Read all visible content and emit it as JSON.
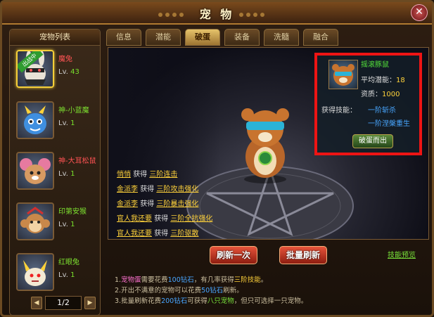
{
  "window": {
    "title": "宠 物",
    "close_label": "✕"
  },
  "sidebar": {
    "title": "宠物列表",
    "items": [
      {
        "name": "魔兔",
        "level_prefix": "Lv.",
        "level": "43",
        "badge": "出战中"
      },
      {
        "name": "神-小蓝魔",
        "level_prefix": "Lv.",
        "level": "1"
      },
      {
        "name": "神-大耳松鼠",
        "level_prefix": "Lv.",
        "level": "1"
      },
      {
        "name": "印第安猴",
        "level_prefix": "Lv.",
        "level": "1"
      },
      {
        "name": "红眼兔",
        "level_prefix": "Lv.",
        "level": "1"
      }
    ],
    "pager": {
      "page": "1/2",
      "prev": "◀",
      "next": "▶"
    }
  },
  "tabs": [
    {
      "label": "信息"
    },
    {
      "label": "潜能"
    },
    {
      "label": "破蛋"
    },
    {
      "label": "装备"
    },
    {
      "label": "洗髓"
    },
    {
      "label": "融合"
    }
  ],
  "stage": {
    "results": [
      {
        "user": "悄悄",
        "verb": "获得",
        "skill": "三阶连击"
      },
      {
        "user": "金派李",
        "verb": "获得",
        "skill": "三阶攻击强化"
      },
      {
        "user": "金派李",
        "verb": "获得",
        "skill": "三阶暴击强化"
      },
      {
        "user": "官人我还要",
        "verb": "获得",
        "skill": "三阶全抗强化"
      },
      {
        "user": "官人我还要",
        "verb": "获得",
        "skill": "三阶驱散"
      }
    ]
  },
  "info_panel": {
    "name": "摇滚豚鼠",
    "potential_label": "平均潜能：",
    "potential_value": "18",
    "quality_label": "资质：",
    "quality_value": "1000",
    "skills_label": "获得技能：",
    "skills": [
      "一阶斩杀",
      "一阶涅槃重生"
    ],
    "hatch_button": "破蛋而出"
  },
  "buttons": {
    "refresh_once": "刷新一次",
    "batch_refresh": "批量刷新",
    "skill_preview": "技能预览"
  },
  "notes": {
    "n1_a": "1.",
    "n1_b": "宠物蛋",
    "n1_c": "需要花费",
    "n1_d": "100钻石",
    "n1_e": "，有几率获得",
    "n1_f": "三阶技能",
    "n1_g": "。",
    "n2_a": "2.开出不满意的宠物可以花费",
    "n2_b": "50钻石",
    "n2_c": "刷新。",
    "n3_a": "3.批量刷新花费",
    "n3_b": "200钻石",
    "n3_c": "可获得",
    "n3_d": "八只宠物",
    "n3_e": "，但只可选择一只宠物。"
  },
  "colors": {
    "frame": "#6b4a22",
    "highlight": "#ee1414",
    "gold": "#ffd23a",
    "green": "#78e13a",
    "blue": "#48a6ff"
  }
}
